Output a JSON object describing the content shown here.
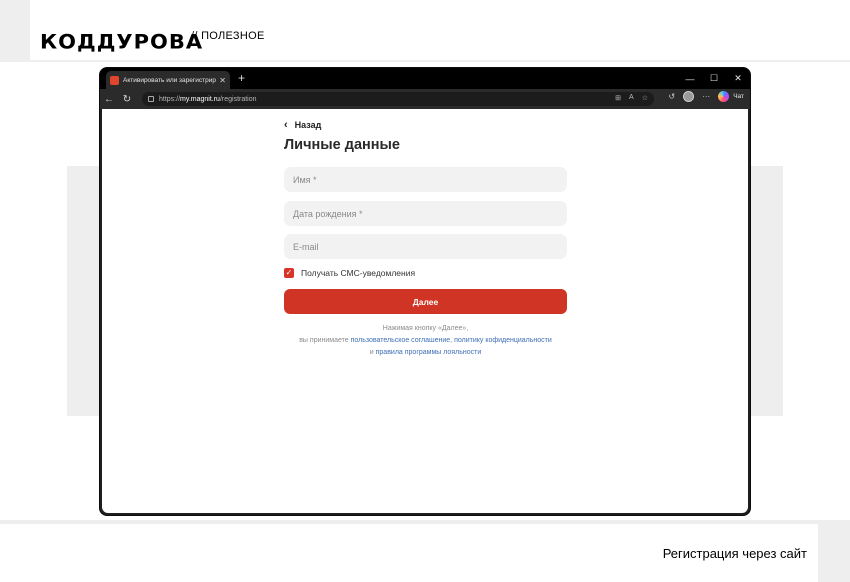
{
  "brand": {
    "logo": "КОДДУРОВА",
    "section": "// ПОЛЕЗНОЕ"
  },
  "caption": "Регистрация через сайт",
  "browser": {
    "tab_title": "Активировать или зарегистриров",
    "tab_close": "✕",
    "new_tab": "+",
    "window_controls": {
      "minimize": "—",
      "maximize": "☐",
      "close": "✕"
    },
    "url_prefix": "https://",
    "url_host": "my.magnit.ru",
    "url_path": "/registration",
    "chat_label": "Чат"
  },
  "page": {
    "back_label": "Назад",
    "title": "Личные данные",
    "fields": {
      "name_placeholder": "Имя *",
      "birthdate_placeholder": "Дата рождения *",
      "email_placeholder": "E-mail"
    },
    "sms_checkbox": {
      "label": "Получать СМС-уведомления",
      "checked": true,
      "mark": "✓"
    },
    "submit_label": "Далее",
    "legal": {
      "line1": "Нажимая кнопку «Далее»,",
      "line2_prefix": "вы принимаете ",
      "link_agreement": "пользовательское соглашение",
      "comma": ", ",
      "link_privacy": "политику кофиденциальности",
      "line3_prefix": "и ",
      "link_loyalty": "правила программы лояльности"
    }
  },
  "colors": {
    "accent": "#d03424",
    "link": "#3f6fb5"
  }
}
